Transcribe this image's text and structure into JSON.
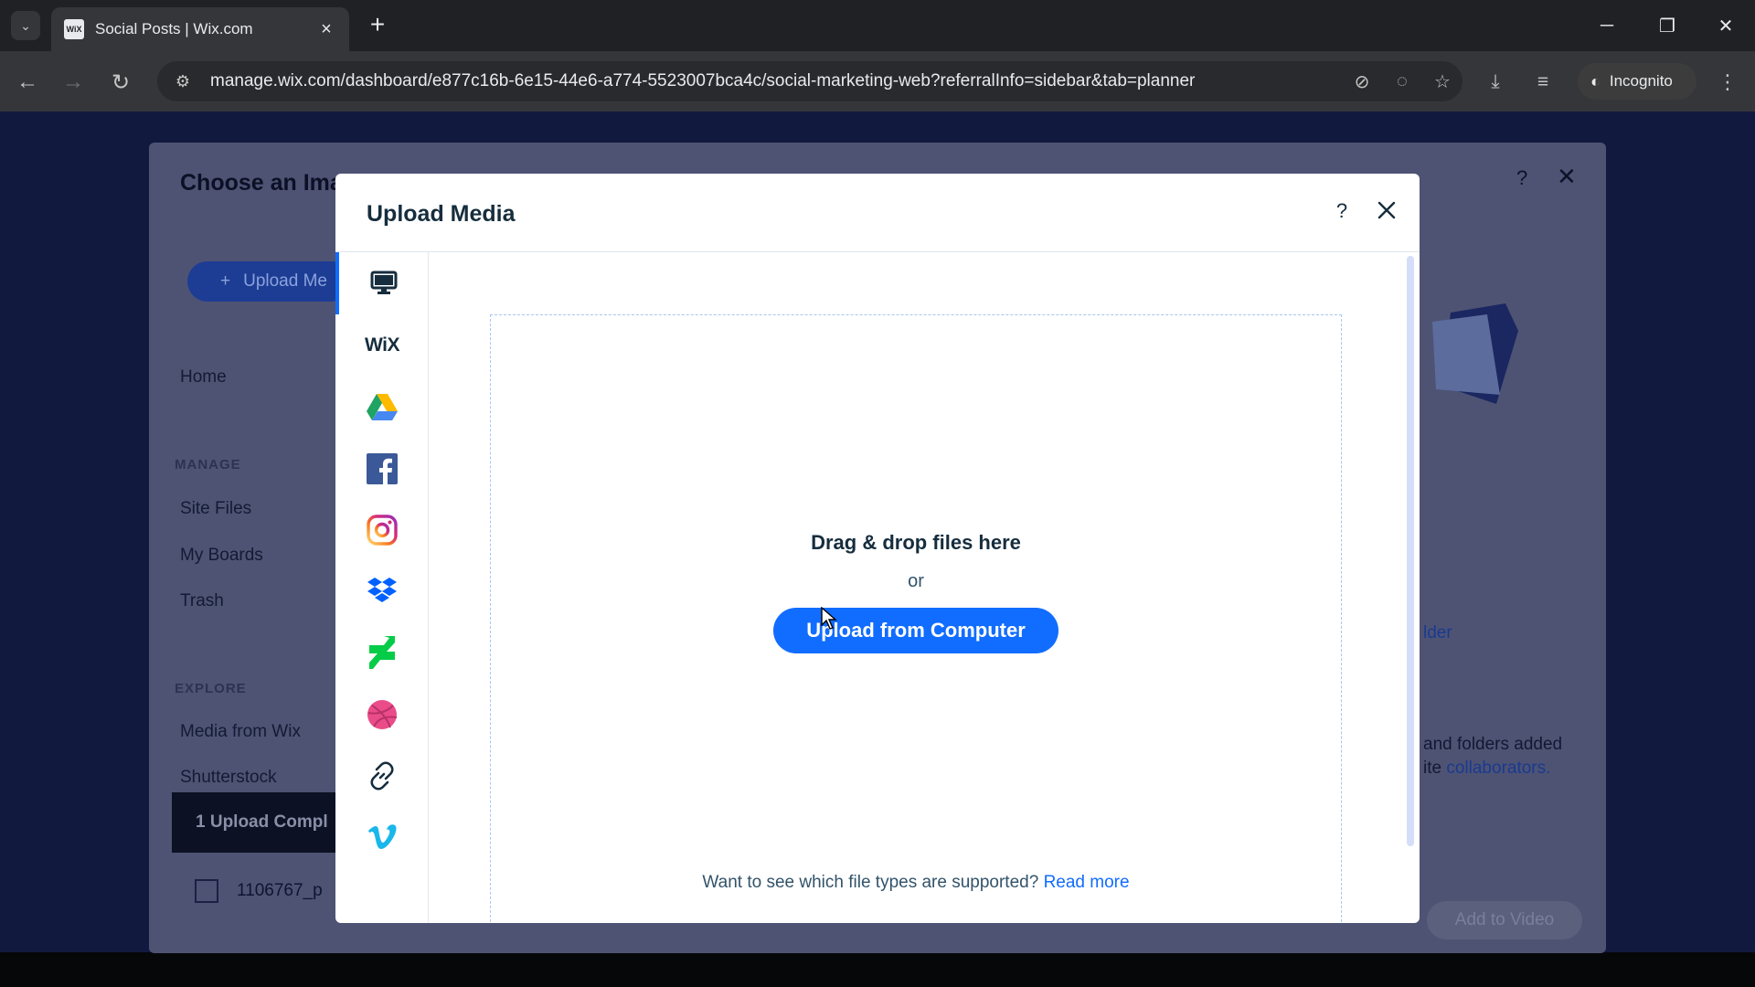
{
  "browser": {
    "tab_title": "Social Posts | Wix.com",
    "favicon_text": "WiX",
    "url": "manage.wix.com/dashboard/e877c16b-6e15-44e6-a774-5523007bca4c/social-marketing-web?referralInfo=sidebar&tab=planner",
    "incognito_label": "Incognito"
  },
  "background_modal": {
    "title": "Choose an Ima",
    "upload_button": "Upload Me",
    "nav_home": "Home",
    "section_manage": "MANAGE",
    "nav_site_files": "Site Files",
    "nav_my_boards": "My Boards",
    "nav_trash": "Trash",
    "section_explore": "EXPLORE",
    "nav_media_from_wix": "Media from Wix",
    "nav_shutterstock": "Shutterstock",
    "upload_complete": "1 Upload Compl",
    "file_name": "1106767_p",
    "side_text_folder": "lder",
    "side_text_line1": "and folders added",
    "side_text_line2_prefix": "ite ",
    "side_text_link": "collaborators.",
    "add_to_video": "Add to Video"
  },
  "upload_dialog": {
    "title": "Upload Media",
    "help": "?",
    "sources": [
      {
        "name": "computer",
        "icon": "monitor-icon",
        "active": true
      },
      {
        "name": "wix",
        "label": "WiX",
        "icon": "wix-logo"
      },
      {
        "name": "google-drive",
        "icon": "google-drive-icon"
      },
      {
        "name": "facebook",
        "icon": "facebook-icon"
      },
      {
        "name": "instagram",
        "icon": "instagram-icon"
      },
      {
        "name": "dropbox",
        "icon": "dropbox-icon"
      },
      {
        "name": "deviantart",
        "icon": "deviantart-icon"
      },
      {
        "name": "dribbble",
        "icon": "dribbble-icon"
      },
      {
        "name": "link",
        "icon": "link-icon"
      },
      {
        "name": "vimeo",
        "icon": "vimeo-icon"
      }
    ],
    "drop_title": "Drag & drop files here",
    "drop_or": "or",
    "upload_button": "Upload from Computer",
    "footer_text": "Want to see which file types are supported?",
    "footer_link": "Read more"
  },
  "colors": {
    "accent": "#116dff",
    "dialog_bg": "#ffffff",
    "text_primary": "#162d3d"
  }
}
